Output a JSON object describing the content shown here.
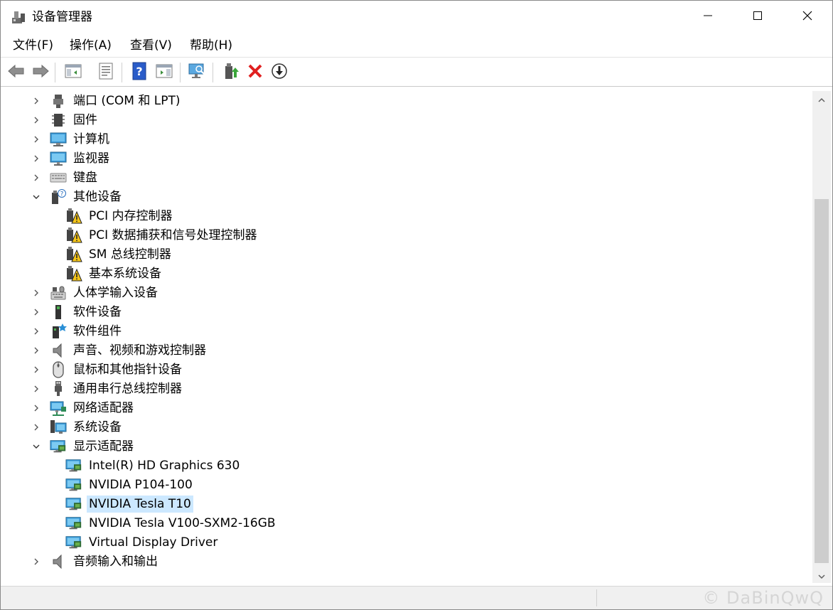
{
  "window": {
    "title": "设备管理器",
    "controls": {
      "minimize": "minimize-icon",
      "maximize": "maximize-icon",
      "close": "close-icon"
    }
  },
  "menu": [
    "文件(F)",
    "操作(A)",
    "查看(V)",
    "帮助(H)"
  ],
  "toolbar": [
    "back-arrow-icon",
    "forward-arrow-icon",
    "show-hide-console-tree-icon",
    "properties-icon",
    "help-icon",
    "action-pane-icon",
    "scan-hardware-icon",
    "update-driver-icon",
    "uninstall-device-icon",
    "disable-device-icon"
  ],
  "tree": [
    {
      "label": "端口 (COM 和 LPT)",
      "icon": "port-icon",
      "expanded": false,
      "level": 0
    },
    {
      "label": "固件",
      "icon": "firmware-icon",
      "expanded": false,
      "level": 0
    },
    {
      "label": "计算机",
      "icon": "computer-icon",
      "expanded": false,
      "level": 0
    },
    {
      "label": "监视器",
      "icon": "monitor-icon",
      "expanded": false,
      "level": 0
    },
    {
      "label": "键盘",
      "icon": "keyboard-icon",
      "expanded": false,
      "level": 0
    },
    {
      "label": "其他设备",
      "icon": "unknown-device-icon",
      "expanded": true,
      "level": 0
    },
    {
      "label": "PCI 内存控制器",
      "icon": "warning-device-icon",
      "level": 1
    },
    {
      "label": "PCI 数据捕获和信号处理控制器",
      "icon": "warning-device-icon",
      "level": 1
    },
    {
      "label": "SM 总线控制器",
      "icon": "warning-device-icon",
      "level": 1
    },
    {
      "label": "基本系统设备",
      "icon": "warning-device-icon",
      "level": 1
    },
    {
      "label": "人体学输入设备",
      "icon": "hid-icon",
      "expanded": false,
      "level": 0
    },
    {
      "label": "软件设备",
      "icon": "software-device-icon",
      "expanded": false,
      "level": 0
    },
    {
      "label": "软件组件",
      "icon": "software-component-icon",
      "expanded": false,
      "level": 0
    },
    {
      "label": "声音、视频和游戏控制器",
      "icon": "speaker-icon",
      "expanded": false,
      "level": 0
    },
    {
      "label": "鼠标和其他指针设备",
      "icon": "mouse-icon",
      "expanded": false,
      "level": 0
    },
    {
      "label": "通用串行总线控制器",
      "icon": "usb-icon",
      "expanded": false,
      "level": 0
    },
    {
      "label": "网络适配器",
      "icon": "network-adapter-icon",
      "expanded": false,
      "level": 0
    },
    {
      "label": "系统设备",
      "icon": "system-device-icon",
      "expanded": false,
      "level": 0
    },
    {
      "label": "显示适配器",
      "icon": "display-adapter-icon",
      "expanded": true,
      "level": 0
    },
    {
      "label": "Intel(R) HD Graphics 630",
      "icon": "display-adapter-icon",
      "level": 1
    },
    {
      "label": "NVIDIA P104-100",
      "icon": "display-adapter-icon",
      "level": 1
    },
    {
      "label": "NVIDIA Tesla T10",
      "icon": "display-adapter-icon",
      "level": 1,
      "selected": true
    },
    {
      "label": "NVIDIA Tesla V100-SXM2-16GB",
      "icon": "display-adapter-icon",
      "level": 1
    },
    {
      "label": "Virtual Display Driver",
      "icon": "display-adapter-icon",
      "level": 1
    },
    {
      "label": "音频输入和输出",
      "icon": "speaker-icon",
      "expanded": false,
      "level": 0
    }
  ],
  "watermark": "© DaBinQwQ",
  "colors": {
    "selection": "#cce8ff",
    "scrollbar_thumb": "#cdcdcd",
    "warning": "#f5c518",
    "delete_red": "#e02020",
    "help_blue": "#2a5cc9"
  }
}
